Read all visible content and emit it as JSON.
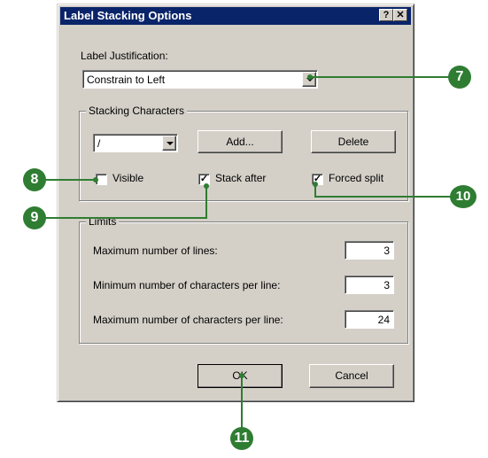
{
  "dialog": {
    "title": "Label Stacking Options",
    "help_button": "?",
    "close_button": "✕"
  },
  "justification": {
    "label": "Label Justification:",
    "value": "Constrain to Left"
  },
  "stacking": {
    "group_title": "Stacking Characters",
    "char_value": "/",
    "add_label": "Add...",
    "delete_label": "Delete",
    "visible_label": "Visible",
    "visible_checked": false,
    "stack_after_label": "Stack after",
    "stack_after_checked": true,
    "forced_split_label": "Forced split",
    "forced_split_checked": true
  },
  "limits": {
    "group_title": "Limits",
    "max_lines_label": "Maximum number of lines:",
    "max_lines_value": "3",
    "min_chars_label": "Minimum number of characters per line:",
    "min_chars_value": "3",
    "max_chars_label": "Maximum number of characters per line:",
    "max_chars_value": "24"
  },
  "buttons": {
    "ok_label": "OK",
    "cancel_label": "Cancel"
  },
  "callouts": {
    "c7": "7",
    "c8": "8",
    "c9": "9",
    "c10": "10",
    "c11": "11"
  },
  "colors": {
    "callout": "#2f7d32",
    "titlebar": "#0a246a",
    "dialog_face": "#d4d0c8"
  }
}
